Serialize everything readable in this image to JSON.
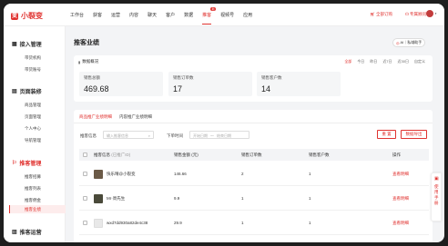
{
  "brand": {
    "name": "小裂变",
    "accent": "#e0322f"
  },
  "nav": {
    "items": [
      "工作台",
      "获客",
      "运营",
      "内容",
      "聊天",
      "客户",
      "数据",
      "推客",
      "视频号",
      "应用"
    ],
    "active": "推客",
    "new_badge": "新"
  },
  "top_right": {
    "order": "全部订购",
    "service": "专属顾问"
  },
  "sidebar": {
    "sections": [
      {
        "title": "接入管理",
        "items": [
          "带货机构",
          "带货账号"
        ]
      },
      {
        "title": "页面装修",
        "items": [
          "商品管理",
          "页面管理",
          "个人中心",
          "导航管理"
        ]
      },
      {
        "title": "推客管理",
        "items": [
          "推客招募",
          "推客列表",
          "推客佣金",
          "推客业绩"
        ]
      },
      {
        "title": "推客运营",
        "items": []
      }
    ],
    "active_item": "推客业绩"
  },
  "page": {
    "title": "推客业绩",
    "ai_button": "AI｜私域助手"
  },
  "overview": {
    "title": "数据概况",
    "ranges": [
      "全部",
      "今日",
      "昨日",
      "近7日",
      "近30日",
      "自定义"
    ],
    "active_range": "全部",
    "stats": [
      {
        "label": "销售总额",
        "value": "469.68"
      },
      {
        "label": "销售订单数",
        "value": "17"
      },
      {
        "label": "销售客户数",
        "value": "14"
      }
    ]
  },
  "detail": {
    "tabs": [
      "商品推广业绩明细",
      "内容推广业绩明细"
    ],
    "active_tab": "商品推广业绩明细",
    "filter": {
      "label": "推客信息",
      "placeholder": "输入推客信息",
      "time_label": "下单时间",
      "start_placeholder": "开始日期",
      "sep": "～",
      "end_placeholder": "结束日期"
    },
    "reset": "重 置",
    "export": "数据导出",
    "columns": {
      "info": "推客信息",
      "info_hint": "(已推广ID)",
      "sales": "销售金额 (元)",
      "orders": "销售订单数",
      "customers": "销售客户数",
      "ops": "操作"
    },
    "rows": [
      {
        "name": "快乐晴@小裂变",
        "sales": "146.66",
        "orders": "2",
        "customers": "1",
        "op": "查看明细"
      },
      {
        "name": "Mr·周先生",
        "sales": "9.9",
        "orders": "1",
        "customers": "1",
        "op": "查看明细"
      },
      {
        "name": "wxd7dd930a82de4c38",
        "sales": "29.9",
        "orders": "1",
        "customers": "1",
        "op": "查看明细"
      }
    ]
  },
  "float": {
    "label": "使用手册"
  }
}
